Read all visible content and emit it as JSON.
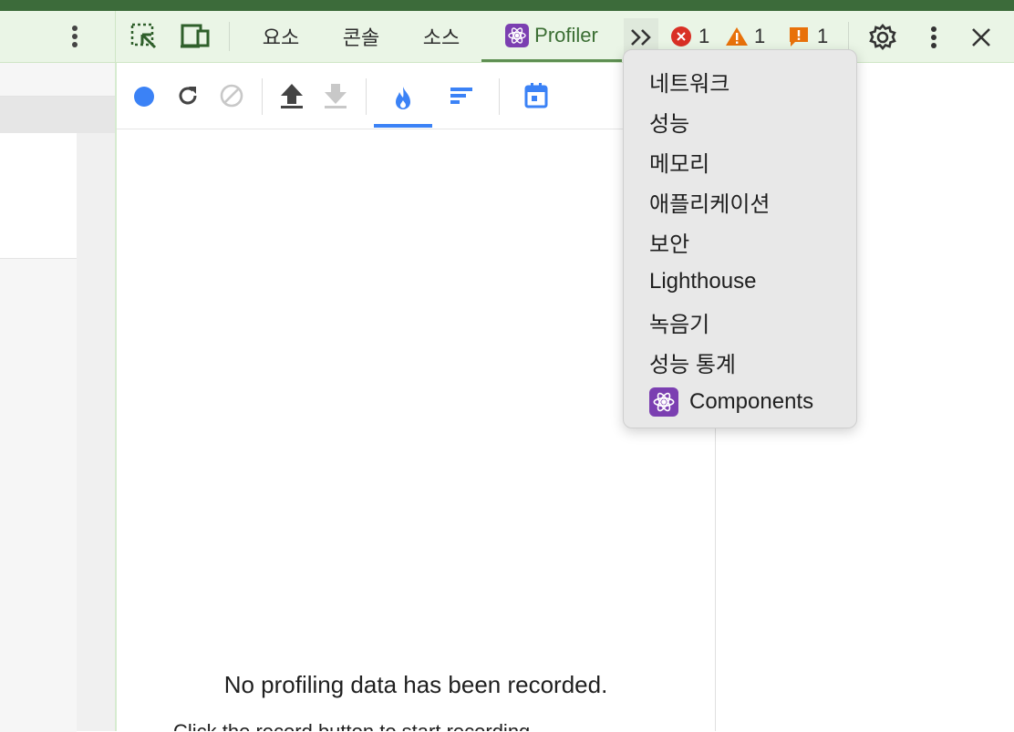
{
  "tabs": [
    {
      "label": "요소"
    },
    {
      "label": "콘솔"
    },
    {
      "label": "소스"
    },
    {
      "label": "Profiler"
    }
  ],
  "badges": {
    "errors": "1",
    "warnings": "1",
    "issues": "1"
  },
  "colors": {
    "accent": "#3b6e33",
    "blue": "#3b82f6",
    "error": "#d93025",
    "warning": "#e8710a"
  },
  "overflow_menu": {
    "items": [
      {
        "label": "네트워크"
      },
      {
        "label": "성능"
      },
      {
        "label": "메모리"
      },
      {
        "label": "애플리케이션"
      },
      {
        "label": "보안"
      },
      {
        "label": "Lighthouse"
      },
      {
        "label": "녹음기"
      },
      {
        "label": "성능 통계"
      },
      {
        "label": "Components",
        "icon": "react-atom-icon"
      }
    ]
  },
  "main": {
    "empty_message": "No profiling data has been recorded.",
    "hint_partial": "Click the record button  to start recording."
  }
}
